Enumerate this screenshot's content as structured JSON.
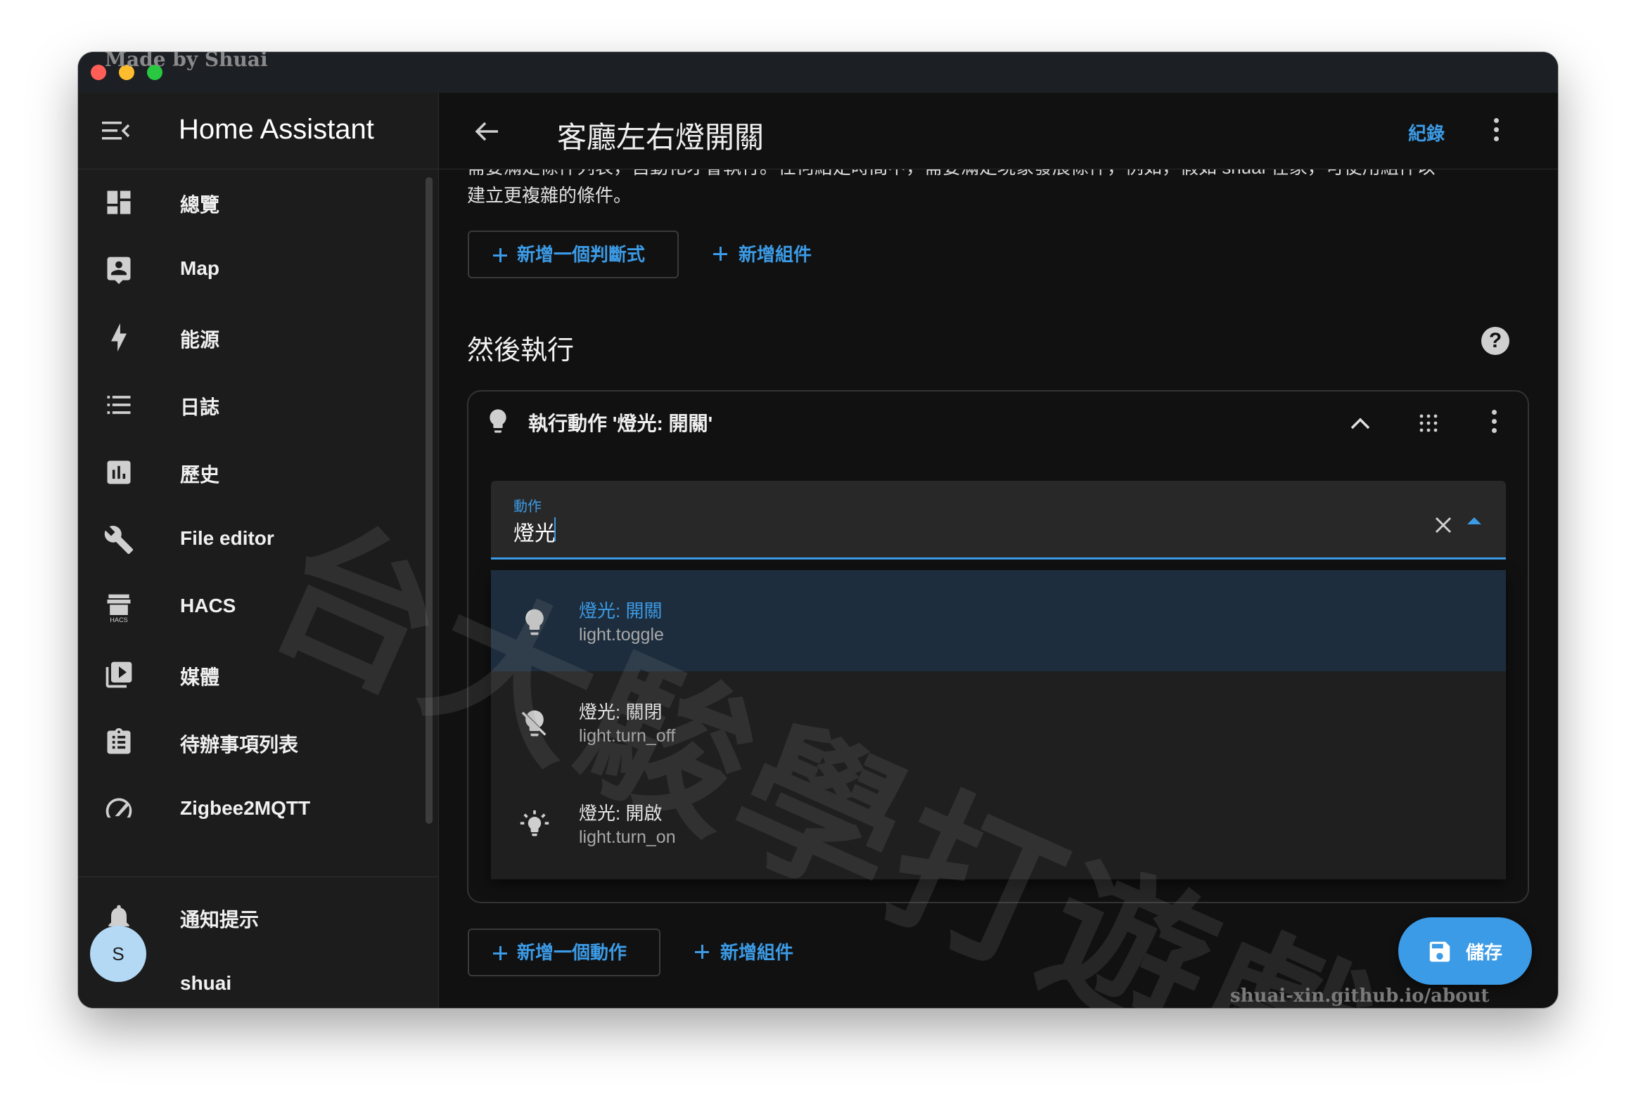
{
  "overlay": {
    "made_by": "Made by Shuai",
    "watermark": "台大駿學打遊戲",
    "footer_url": "shuai-xin.github.io/about"
  },
  "sidebar": {
    "app_title": "Home Assistant",
    "items": [
      {
        "label": "總覽",
        "icon": "dashboard-icon"
      },
      {
        "label": "Map",
        "icon": "map-person-icon"
      },
      {
        "label": "能源",
        "icon": "lightning-bolt-icon"
      },
      {
        "label": "日誌",
        "icon": "list-icon"
      },
      {
        "label": "歷史",
        "icon": "chart-bar-icon"
      },
      {
        "label": "File editor",
        "icon": "wrench-icon"
      },
      {
        "label": "HACS",
        "icon": "hacs-store-icon"
      },
      {
        "label": "媒體",
        "icon": "play-box-multiple-icon"
      },
      {
        "label": "待辦事項列表",
        "icon": "clipboard-list-icon"
      },
      {
        "label": "Zigbee2MQTT",
        "icon": "zigbee-icon"
      }
    ],
    "notifications_label": "通知提示",
    "user": {
      "initial": "S",
      "name": "shuai"
    }
  },
  "header": {
    "title": "客廳左右燈開關",
    "log_link": "紀錄"
  },
  "conditions": {
    "intro_clipped": "需要滿足條件列表，自動化才會執行。任何給定時間中，需要滿足現象發展條件，例如，假如 shuai 在家，可使用組件以",
    "intro_second_line": "建立更複雜的條件。",
    "add_condition_label": "新增一個判斷式",
    "add_building_block_label": "新增組件"
  },
  "actions": {
    "section_title": "然後執行",
    "card_title": "執行動作 '燈光: 開關'",
    "combo": {
      "label": "動作",
      "value": "燈光",
      "options": [
        {
          "title": "燈光: 開關",
          "service": "light.toggle",
          "icon": "lightbulb-icon",
          "selected": true
        },
        {
          "title": "燈光: 關閉",
          "service": "light.turn_off",
          "icon": "lightbulb-off-icon",
          "selected": false
        },
        {
          "title": "燈光: 開啟",
          "service": "light.turn_on",
          "icon": "lightbulb-on-icon",
          "selected": false
        }
      ]
    },
    "add_action_label": "新增一個動作",
    "add_building_block_label": "新增組件"
  },
  "save_label": "儲存",
  "colors": {
    "accent": "#3c9be6",
    "background": "#111111",
    "sidebar": "#1c1c1c",
    "selected_option": "#1d2d3d",
    "avatar": "#b3d9f5"
  }
}
